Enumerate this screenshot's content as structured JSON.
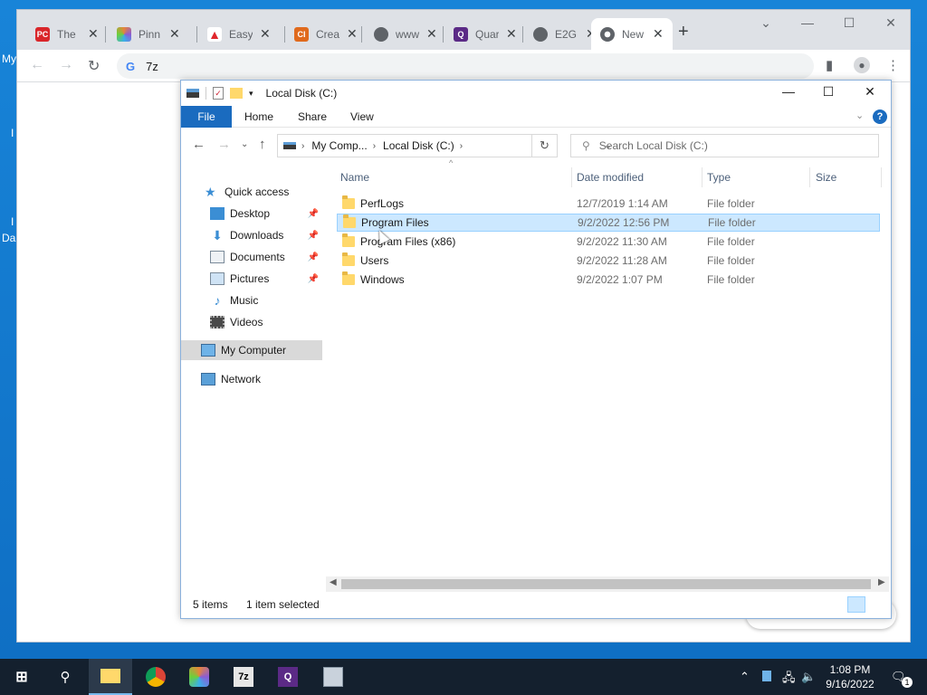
{
  "desktop": {
    "label_top": "My",
    "label_mid1": "I",
    "label_mid2": "I",
    "label_bottom": "Da"
  },
  "chrome": {
    "tabs": [
      {
        "label": "The",
        "favicon": "PC",
        "color": "#d9262a"
      },
      {
        "label": "Pinn",
        "favicon": "pinwheel-icon",
        "color": "#e8843a"
      },
      {
        "label": "Easy",
        "favicon": "adobe-icon",
        "color": "#e0262b"
      },
      {
        "label": "Crea",
        "favicon": "CI",
        "color": "#e06a1d"
      },
      {
        "label": "www.",
        "favicon": "globe-icon",
        "color": "#5f6368"
      },
      {
        "label": "Quar",
        "favicon": "Q",
        "color": "#5b2a86"
      },
      {
        "label": "E2G",
        "favicon": "globe-icon",
        "color": "#5f6368"
      },
      {
        "label": "New",
        "favicon": "chrome-icon",
        "color": "#5f6368"
      }
    ],
    "omnibox_text": "7z",
    "omnibox_prefix": "G",
    "customize_label": "Customize Chrome"
  },
  "explorer": {
    "title": "Local Disk (C:)",
    "ribbon_tabs": {
      "file": "File",
      "home": "Home",
      "share": "Share",
      "view": "View"
    },
    "help": "?",
    "breadcrumb": {
      "part1": "My Comp...",
      "part2": "Local Disk (C:)"
    },
    "search_placeholder": "Search Local Disk (C:)",
    "nav": {
      "quick_access": "Quick access",
      "desktop": "Desktop",
      "downloads": "Downloads",
      "documents": "Documents",
      "pictures": "Pictures",
      "music": "Music",
      "videos": "Videos",
      "my_computer": "My Computer",
      "network": "Network"
    },
    "columns": {
      "name": "Name",
      "date": "Date modified",
      "type": "Type",
      "size": "Size"
    },
    "rows": [
      {
        "name": "PerfLogs",
        "date": "12/7/2019 1:14 AM",
        "type": "File folder"
      },
      {
        "name": "Program Files",
        "date": "9/2/2022 12:56 PM",
        "type": "File folder"
      },
      {
        "name": "Program Files (x86)",
        "date": "9/2/2022 11:30 AM",
        "type": "File folder"
      },
      {
        "name": "Users",
        "date": "9/2/2022 11:28 AM",
        "type": "File folder"
      },
      {
        "name": "Windows",
        "date": "9/2/2022 1:07 PM",
        "type": "File folder"
      }
    ],
    "status": {
      "items": "5 items",
      "selected": "1 item selected"
    }
  },
  "taskbar": {
    "clock_time": "1:08 PM",
    "clock_date": "9/16/2022",
    "notification_count": "1",
    "apps": [
      "file-explorer-icon",
      "chrome-icon",
      "paint-icon",
      "7zip-icon",
      "quartus-icon",
      "app-icon"
    ]
  }
}
